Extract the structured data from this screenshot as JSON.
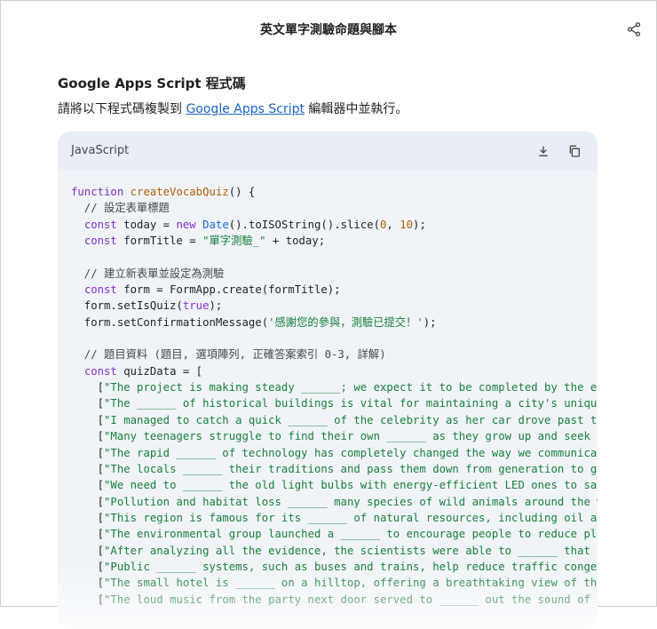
{
  "header": {
    "title": "英文單字測驗命題與腳本",
    "share_icon": "share-icon"
  },
  "section": {
    "heading": "Google Apps Script 程式碼",
    "instruction_before": "請將以下程式碼複製到 ",
    "instruction_link": "Google Apps Script",
    "instruction_after": " 編輯器中並執行。"
  },
  "code_block": {
    "language": "JavaScript",
    "download_icon": "download-icon",
    "copy_icon": "copy-icon",
    "lines": [
      [
        {
          "t": "function ",
          "c": "kw"
        },
        {
          "t": "createVocabQuiz",
          "c": "fn"
        },
        {
          "t": "() {",
          "c": ""
        }
      ],
      [
        {
          "t": "  // 設定表單標題",
          "c": "com"
        }
      ],
      [
        {
          "t": "  ",
          "c": ""
        },
        {
          "t": "const",
          "c": "kw"
        },
        {
          "t": " today = ",
          "c": ""
        },
        {
          "t": "new",
          "c": "kw"
        },
        {
          "t": " ",
          "c": ""
        },
        {
          "t": "Date",
          "c": "cls"
        },
        {
          "t": "().toISOString().slice(",
          "c": ""
        },
        {
          "t": "0",
          "c": "num"
        },
        {
          "t": ", ",
          "c": ""
        },
        {
          "t": "10",
          "c": "num"
        },
        {
          "t": ");",
          "c": ""
        }
      ],
      [
        {
          "t": "  ",
          "c": ""
        },
        {
          "t": "const",
          "c": "kw"
        },
        {
          "t": " formTitle = ",
          "c": ""
        },
        {
          "t": "\"單字測驗_\"",
          "c": "str"
        },
        {
          "t": " + today;",
          "c": ""
        }
      ],
      [
        {
          "t": "",
          "c": ""
        }
      ],
      [
        {
          "t": "  // 建立新表單並設定為測驗",
          "c": "com"
        }
      ],
      [
        {
          "t": "  ",
          "c": ""
        },
        {
          "t": "const",
          "c": "kw"
        },
        {
          "t": " form = FormApp.create(formTitle);",
          "c": ""
        }
      ],
      [
        {
          "t": "  form.setIsQuiz(",
          "c": ""
        },
        {
          "t": "true",
          "c": "kw"
        },
        {
          "t": ");",
          "c": ""
        }
      ],
      [
        {
          "t": "  form.setConfirmationMessage(",
          "c": ""
        },
        {
          "t": "'感謝您的參與，測驗已提交！'",
          "c": "str"
        },
        {
          "t": ");",
          "c": ""
        }
      ],
      [
        {
          "t": "",
          "c": ""
        }
      ],
      [
        {
          "t": "  // 題目資料 (題目, 選項陣列, 正確答案索引 0-3, 詳解)",
          "c": "com"
        }
      ],
      [
        {
          "t": "  ",
          "c": ""
        },
        {
          "t": "const",
          "c": "kw"
        },
        {
          "t": " quizData = [",
          "c": ""
        }
      ],
      [
        {
          "t": "    [",
          "c": ""
        },
        {
          "t": "\"The project is making steady ______; we expect it to be completed by the end",
          "c": "str"
        }
      ],
      [
        {
          "t": "    [",
          "c": ""
        },
        {
          "t": "\"The ______ of historical buildings is vital for maintaining a city's unique",
          "c": "str"
        }
      ],
      [
        {
          "t": "    [",
          "c": ""
        },
        {
          "t": "\"I managed to catch a quick ______ of the celebrity as her car drove past the",
          "c": "str"
        }
      ],
      [
        {
          "t": "    [",
          "c": ""
        },
        {
          "t": "\"Many teenagers struggle to find their own ______ as they grow up and seek in",
          "c": "str"
        }
      ],
      [
        {
          "t": "    [",
          "c": ""
        },
        {
          "t": "\"The rapid ______ of technology has completely changed the way we communicate",
          "c": "str"
        }
      ],
      [
        {
          "t": "    [",
          "c": ""
        },
        {
          "t": "\"The locals ______ their traditions and pass them down from generation to gen",
          "c": "str"
        }
      ],
      [
        {
          "t": "    [",
          "c": ""
        },
        {
          "t": "\"We need to ______ the old light bulbs with energy-efficient LED ones to save",
          "c": "str"
        }
      ],
      [
        {
          "t": "    [",
          "c": ""
        },
        {
          "t": "\"Pollution and habitat loss ______ many species of wild animals around the wo",
          "c": "str"
        }
      ],
      [
        {
          "t": "    [",
          "c": ""
        },
        {
          "t": "\"This region is famous for its ______ of natural resources, including oil and",
          "c": "str"
        }
      ],
      [
        {
          "t": "    [",
          "c": ""
        },
        {
          "t": "\"The environmental group launched a ______ to encourage people to reduce plas",
          "c": "str"
        }
      ],
      [
        {
          "t": "    [",
          "c": ""
        },
        {
          "t": "\"After analyzing all the evidence, the scientists were able to ______ that th",
          "c": "str"
        }
      ],
      [
        {
          "t": "    [",
          "c": ""
        },
        {
          "t": "\"Public ______ systems, such as buses and trains, help reduce traffic congest",
          "c": "str"
        }
      ],
      [
        {
          "t": "    [",
          "c": ""
        },
        {
          "t": "\"The small hotel is ______ on a hilltop, offering a breathtaking view of the",
          "c": "str"
        }
      ],
      [
        {
          "t": "    [",
          "c": ""
        },
        {
          "t": "\"The loud music from the party next door served to ______ out the sound of my",
          "c": "str"
        }
      ]
    ]
  },
  "colors": {
    "keyword": "#8430ce",
    "function": "#b35d00",
    "string": "#188038",
    "class": "#1967d2",
    "link": "#1a62c8",
    "code_background": "#f0f4f9"
  }
}
